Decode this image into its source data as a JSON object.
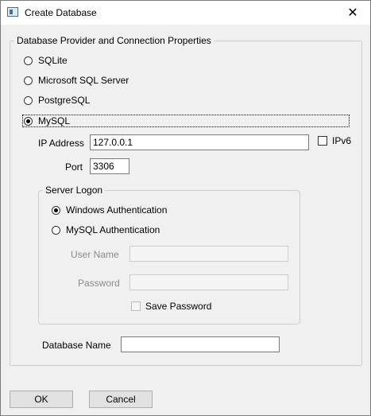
{
  "window": {
    "title": "Create Database",
    "close_glyph": "✕"
  },
  "provider_group": {
    "legend": "Database Provider and Connection Properties",
    "options": [
      "SQLite",
      "Microsoft SQL Server",
      "PostgreSQL",
      "MySQL"
    ],
    "selected": "MySQL"
  },
  "connection": {
    "ip_label": "IP Address",
    "ip_value": "127.0.0.1",
    "ipv6_label": "IPv6",
    "ipv6_checked": false,
    "port_label": "Port",
    "port_value": "3306"
  },
  "server_logon": {
    "legend": "Server Logon",
    "windows_auth_label": "Windows Authentication",
    "mysql_auth_label": "MySQL Authentication",
    "selected": "Windows Authentication",
    "username_label": "User Name",
    "username_value": "",
    "password_label": "Password",
    "password_value": "",
    "save_password_label": "Save Password",
    "save_password_checked": false
  },
  "database": {
    "name_label": "Database Name",
    "name_value": ""
  },
  "buttons": {
    "ok_label": "OK",
    "cancel_label": "Cancel"
  },
  "colors": {
    "window_bg": "#f0f0f0",
    "titlebar_bg": "#ffffff",
    "disabled_text": "#8a8a8a"
  },
  "icons": {
    "app": "database-window-icon",
    "close": "close-icon"
  }
}
